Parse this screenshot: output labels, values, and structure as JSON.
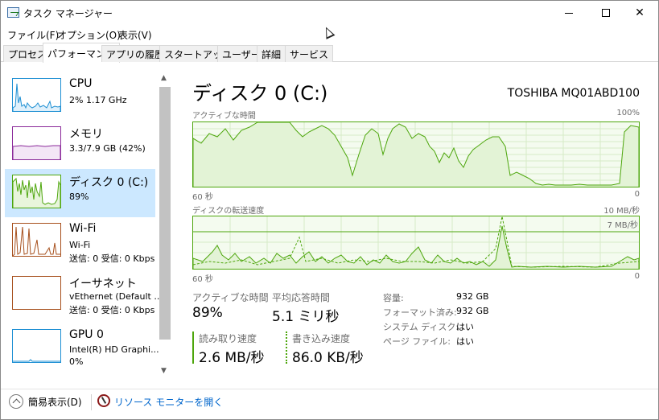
{
  "window": {
    "title": "タスク マネージャー",
    "icon": "task-manager-icon"
  },
  "menu": [
    "ファイル(F)",
    "オプション(O)",
    "表示(V)"
  ],
  "tabs": [
    {
      "label": "プロセス",
      "active": false
    },
    {
      "label": "パフォーマンス",
      "active": true
    },
    {
      "label": "アプリの履歴",
      "active": false
    },
    {
      "label": "スタートアップ",
      "active": false
    },
    {
      "label": "ユーザー",
      "active": false
    },
    {
      "label": "詳細",
      "active": false
    },
    {
      "label": "サービス",
      "active": false
    }
  ],
  "resources": [
    {
      "title": "CPU",
      "sub1": "2%  1.17 GHz",
      "sub2": "",
      "color": "#1d8fd3",
      "active": false
    },
    {
      "title": "メモリ",
      "sub1": "3.3/7.9 GB (42%)",
      "sub2": "",
      "color": "#8b2a9a",
      "active": false
    },
    {
      "title": "ディスク 0 (C:)",
      "sub1": "89%",
      "sub2": "",
      "color": "#4da60c",
      "active": true
    },
    {
      "title": "Wi-Fi",
      "sub1": "Wi-Fi",
      "sub2": "送信: 0 受信: 0 Kbps",
      "color": "#a7501d",
      "active": false
    },
    {
      "title": "イーサネット",
      "sub1": "vEthernet (Default ...",
      "sub2": "送信: 0 受信: 0 Kbps",
      "color": "#a7501d",
      "active": false
    },
    {
      "title": "GPU 0",
      "sub1": "Intel(R) HD Graphi...",
      "sub2": "0%",
      "color": "#1d8fd3",
      "active": false
    }
  ],
  "main": {
    "title": "ディスク 0 (C:)",
    "model": "TOSHIBA MQ01ABD100",
    "graph1": {
      "label": "アクティブな時間",
      "max": "100%",
      "x_left": "60 秒",
      "x_right": "0"
    },
    "graph2": {
      "label": "ディスクの転送速度",
      "max": "10 MB/秒",
      "sub_max": "7 MB/秒",
      "x_left": "60 秒",
      "x_right": "0"
    },
    "stats": {
      "active_time_label": "アクティブな時間",
      "active_time_value": "89%",
      "response_label": "平均応答時間",
      "response_value": "5.1 ミリ秒",
      "read_label": "読み取り速度",
      "read_value": "2.6 MB/秒",
      "write_label": "書き込み速度",
      "write_value": "86.0 KB/秒"
    },
    "props": [
      {
        "key": "容量:",
        "value": "932 GB"
      },
      {
        "key": "フォーマット済み:",
        "value": "932 GB"
      },
      {
        "key": "システム ディスク:",
        "value": "はい"
      },
      {
        "key": "ページ ファイル:",
        "value": "はい"
      }
    ]
  },
  "footer": {
    "fewer_details": "簡易表示(D)",
    "resource_monitor": "リソース モニターを開く"
  }
}
